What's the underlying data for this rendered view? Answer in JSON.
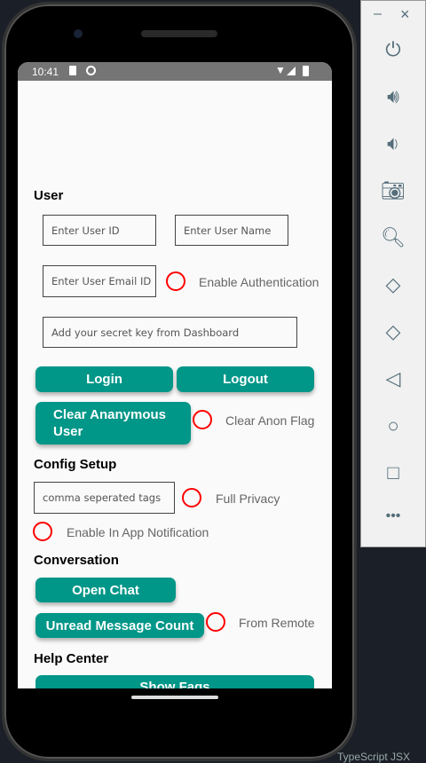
{
  "status_bar": {
    "time": "10:41"
  },
  "user": {
    "heading": "User",
    "user_id_placeholder": "Enter User ID",
    "user_name_placeholder": "Enter User Name",
    "email_placeholder": "Enter User Email ID",
    "enable_auth": "Enable Authentication",
    "secret_placeholder": "Add your secret key from Dashboard",
    "login": "Login",
    "logout": "Logout",
    "clear_anon": "Clear Anonymous User",
    "clear_anon_line1": "Clear Ananymous",
    "clear_anon_line2": "User",
    "clear_anon_flag": "Clear Anon Flag"
  },
  "config": {
    "heading": "Config Setup",
    "tags_placeholder": "comma seperated tags",
    "full_privacy": "Full Privacy",
    "in_app": "Enable In App Notification"
  },
  "conversation": {
    "heading": "Conversation",
    "open_chat": "Open Chat",
    "unread": "Unread Message Count",
    "from_remote": "From Remote"
  },
  "help": {
    "heading": "Help Center",
    "show_faqs": "Show Faqs"
  },
  "emulator_panel": {
    "minimize": "–",
    "close": "×",
    "icons": [
      "power-icon",
      "volume-up-icon",
      "volume-down-icon",
      "camera-icon",
      "zoom-icon",
      "rotate-left-icon",
      "rotate-right-icon",
      "back-icon",
      "home-icon",
      "overview-icon",
      "more-icon"
    ]
  },
  "editor_footer": "TypeScript JSX",
  "colors": {
    "accent": "#009688",
    "radio": "#ff0000"
  }
}
